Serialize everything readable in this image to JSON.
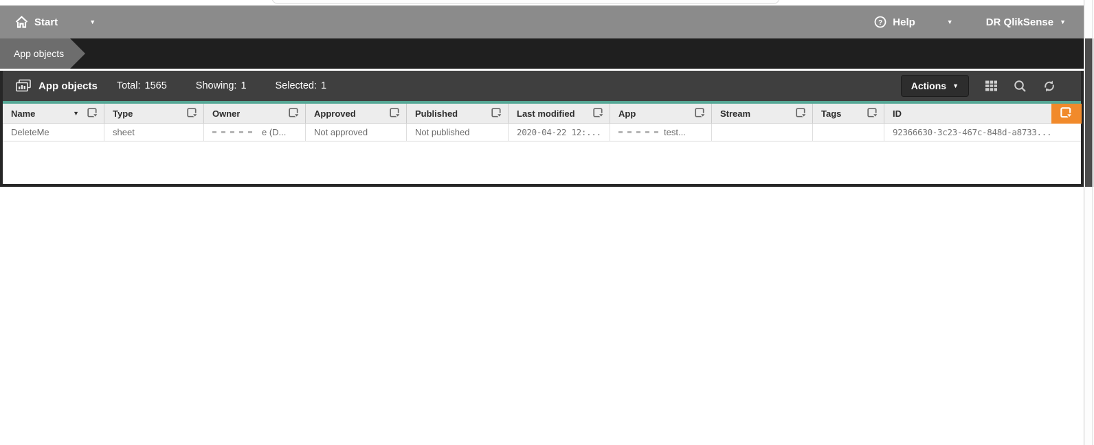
{
  "topbar": {
    "start": {
      "label": "Start",
      "icon": "home-icon",
      "caret": "▼"
    },
    "help": {
      "label": "Help",
      "icon": "help-icon",
      "caret": "▼"
    },
    "user": {
      "label": "DR QlikSense",
      "caret": "▼"
    }
  },
  "breadcrumb": {
    "tab_label": "App objects"
  },
  "toolbar": {
    "icon": "app-objects-icon",
    "title": "App objects",
    "total_label": "Total:",
    "total_value": "1565",
    "showing_label": "Showing:",
    "showing_value": "1",
    "selected_label": "Selected:",
    "selected_value": "1",
    "actions_label": "Actions",
    "actions_caret": "▼",
    "icons": [
      "column-selector-icon",
      "search-icon",
      "refresh-icon"
    ]
  },
  "table": {
    "columns": [
      {
        "label": "Name",
        "sorted": "desc",
        "filter": "filter-icon"
      },
      {
        "label": "Type",
        "filter": "filter-icon"
      },
      {
        "label": "Owner",
        "filter": "filter-icon"
      },
      {
        "label": "Approved",
        "filter": "filter-icon"
      },
      {
        "label": "Published",
        "filter": "filter-icon"
      },
      {
        "label": "Last modified",
        "filter": "filter-icon"
      },
      {
        "label": "App",
        "filter": "filter-icon"
      },
      {
        "label": "Stream",
        "filter": "filter-icon"
      },
      {
        "label": "Tags",
        "filter": "filter-icon"
      },
      {
        "label": "ID",
        "filter": "filter-icon",
        "filter_active": true
      }
    ],
    "rows": [
      {
        "name": "DeleteMe",
        "type": "sheet",
        "owner_visible": "e (D...",
        "owner_redacted": true,
        "approved": "Not approved",
        "published": "Not published",
        "last_modified": "2020-04-22 12:...",
        "app_visible": "test...",
        "app_redacted": true,
        "stream": "",
        "tags": "",
        "id": "92366630-3c23-467c-848d-a8733..."
      }
    ]
  },
  "colors": {
    "accent_green": "#55a795",
    "accent_orange": "#f18a2b",
    "topbar_gray": "#8b8b8b",
    "breadcrumb_dark": "#1f1f1f",
    "tab_gray": "#6d6d6d",
    "panel_titlebar": "#3f3f3f",
    "panel_border": "#262626"
  }
}
